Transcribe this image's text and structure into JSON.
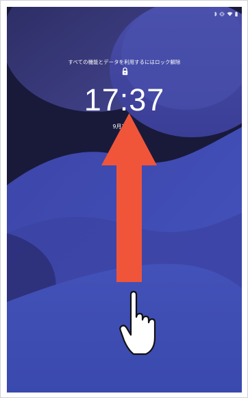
{
  "lockscreen": {
    "unlock_message": "すべての機能とデータを利用するにはロック解除",
    "time": "17:37",
    "date": "9月7日水"
  },
  "status_bar": {
    "icons": [
      "bluetooth-icon",
      "vibrate-icon",
      "wifi-icon",
      "battery-icon"
    ]
  },
  "gesture_hint": {
    "arrow_icon": "swipe-up-arrow-icon",
    "hand_icon": "pointing-hand-icon",
    "arrow_color": "#f0553a"
  },
  "colors": {
    "background_dark": "#191a3a",
    "wave_blue": "#3b4cb0",
    "bubble_purple": "#3f3f8e"
  }
}
